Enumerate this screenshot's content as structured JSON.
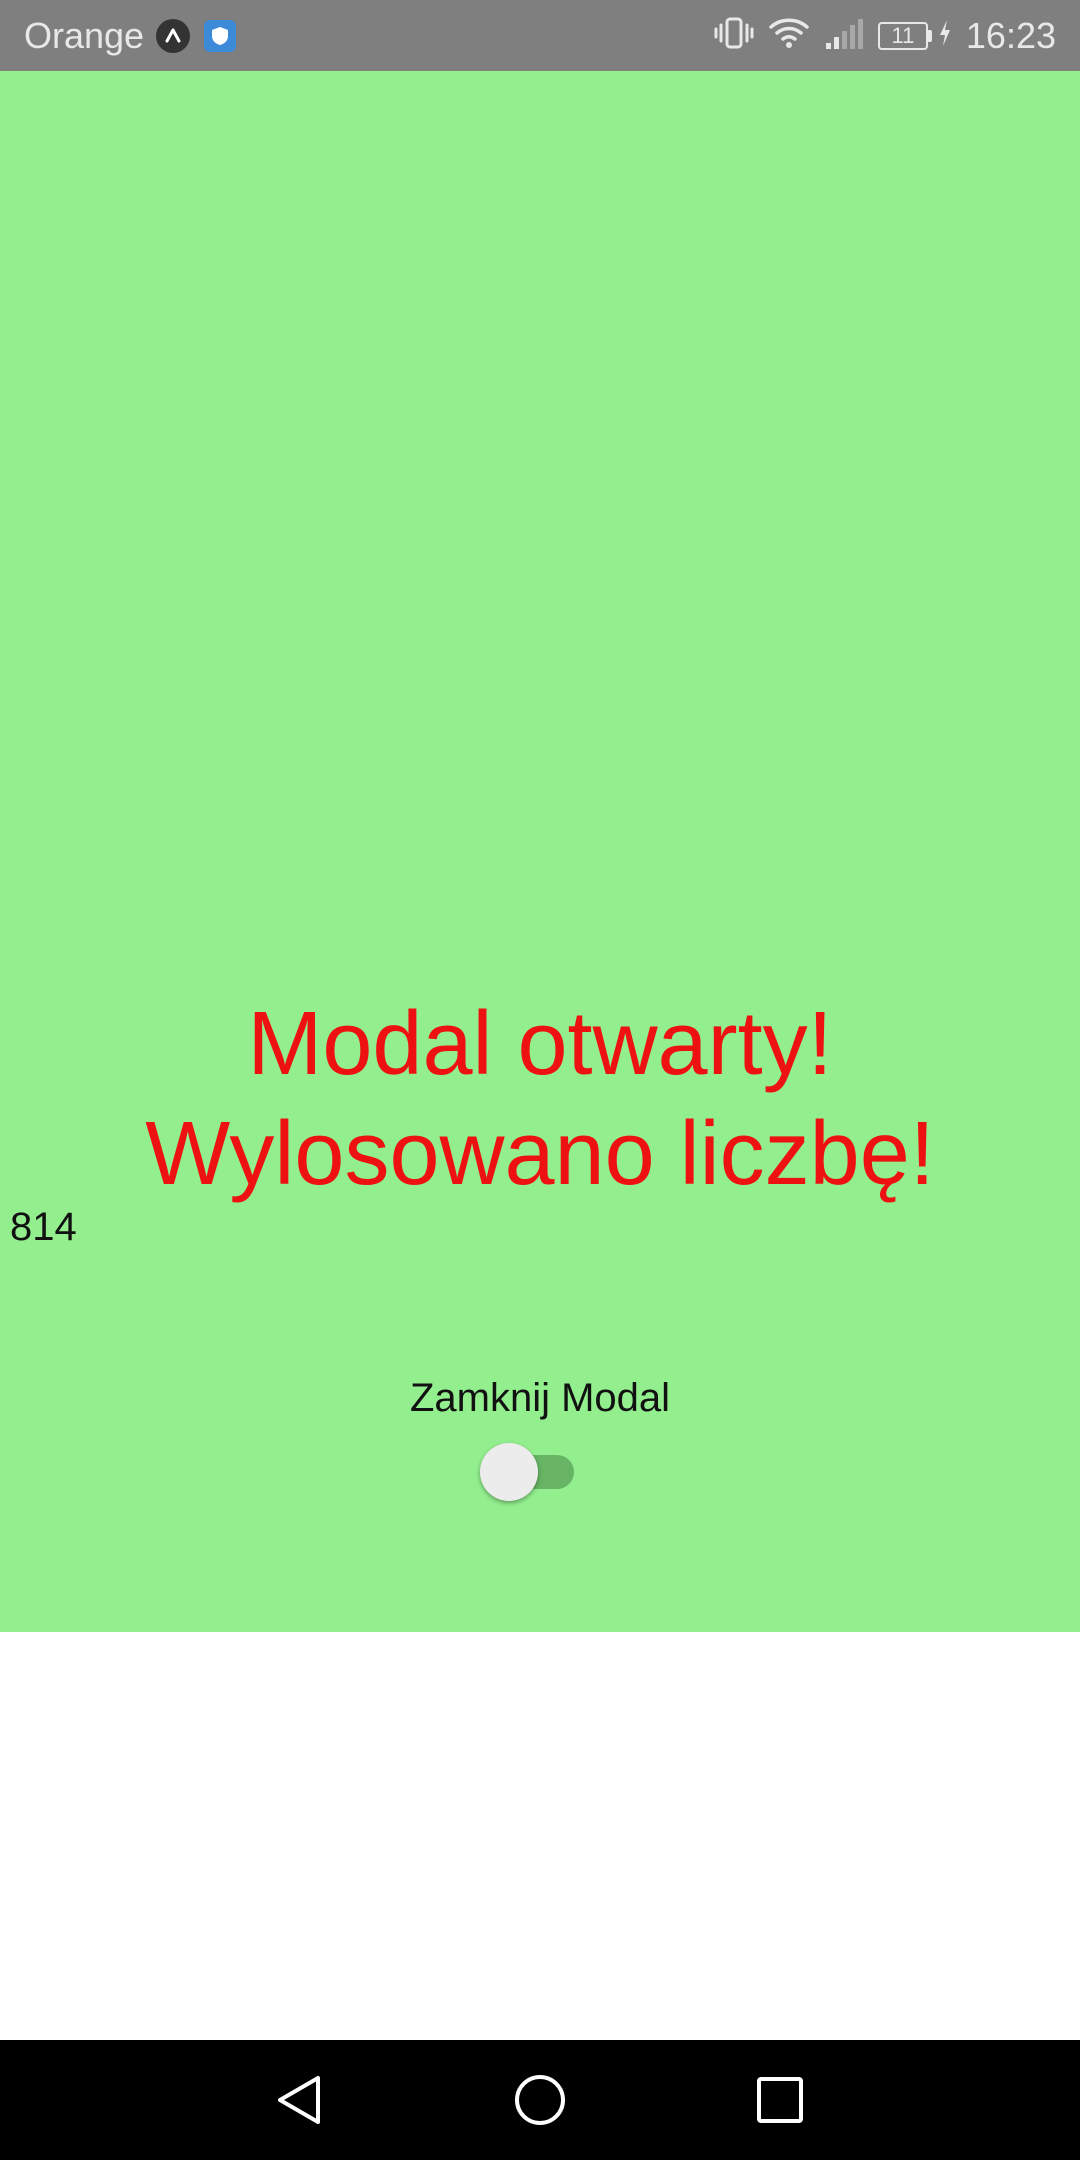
{
  "status_bar": {
    "carrier": "Orange",
    "battery_level": "11",
    "time": "16:23",
    "icons": [
      "app-notification-icon",
      "shield-icon",
      "vibrate-icon",
      "wifi-icon",
      "signal-icon",
      "battery-icon",
      "charging-icon"
    ]
  },
  "modal": {
    "background_color": "#93ef8e",
    "title_line1": "Modal otwarty!",
    "title_line2": "Wylosowano liczbę!",
    "title_color": "#ee1111",
    "random_number": "814",
    "close_label": "Zamknij Modal",
    "switch_on": false
  },
  "nav_bar": {
    "icons": [
      "back-icon",
      "home-icon",
      "recents-icon"
    ]
  }
}
